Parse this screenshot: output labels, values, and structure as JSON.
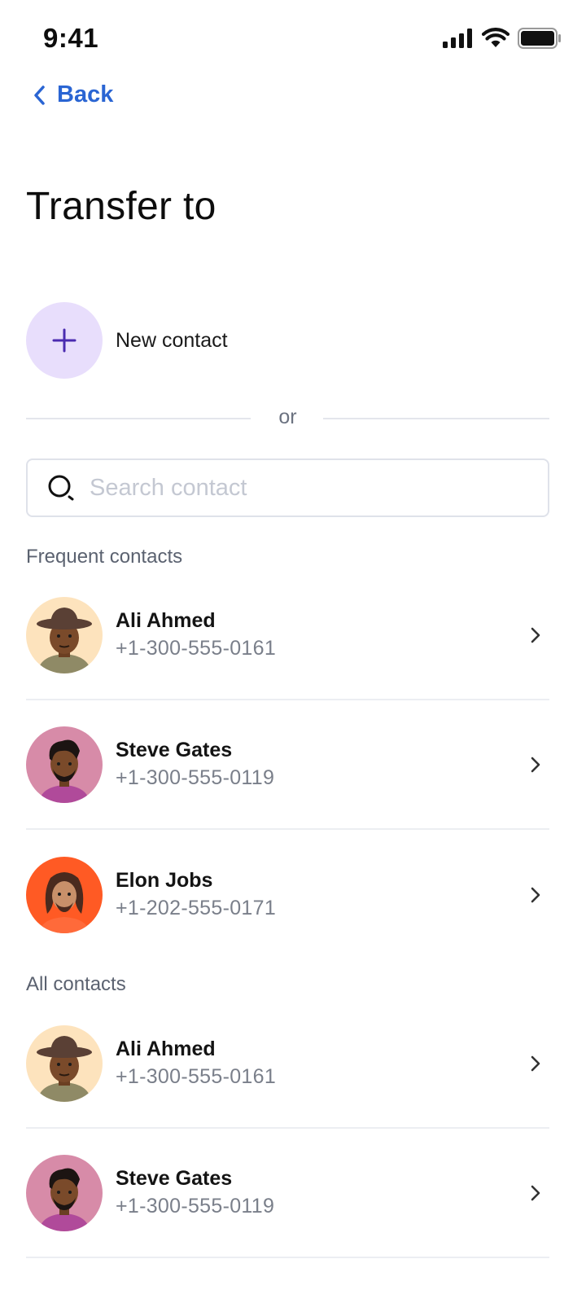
{
  "status_bar": {
    "time": "9:41"
  },
  "header": {
    "back_label": "Back",
    "title": "Transfer to"
  },
  "new_contact": {
    "label": "New contact"
  },
  "divider": {
    "or_text": "or"
  },
  "search": {
    "placeholder": "Search contact",
    "value": ""
  },
  "frequent": {
    "label": "Frequent contacts",
    "contacts": [
      {
        "name": "Ali Ahmed",
        "phone": "+1-300-555-0161",
        "avatar_color": "#fde3bd"
      },
      {
        "name": "Steve Gates",
        "phone": "+1-300-555-0119",
        "avatar_color": "#d78ba8"
      },
      {
        "name": "Elon Jobs",
        "phone": "+1-202-555-0171",
        "avatar_color": "#ff5a24"
      }
    ]
  },
  "all": {
    "label": "All contacts",
    "contacts": [
      {
        "name": "Ali Ahmed",
        "phone": "+1-300-555-0161",
        "avatar_color": "#fde3bd"
      },
      {
        "name": "Steve Gates",
        "phone": "+1-300-555-0119",
        "avatar_color": "#d78ba8"
      }
    ]
  },
  "colors": {
    "accent": "#2a65d3",
    "plus_bg": "#e8defc",
    "plus_icon": "#4a2bb0"
  },
  "icons": [
    "signal-icon",
    "wifi-icon",
    "battery-icon",
    "chevron-left-icon",
    "plus-icon",
    "search-icon",
    "chevron-right-icon"
  ]
}
